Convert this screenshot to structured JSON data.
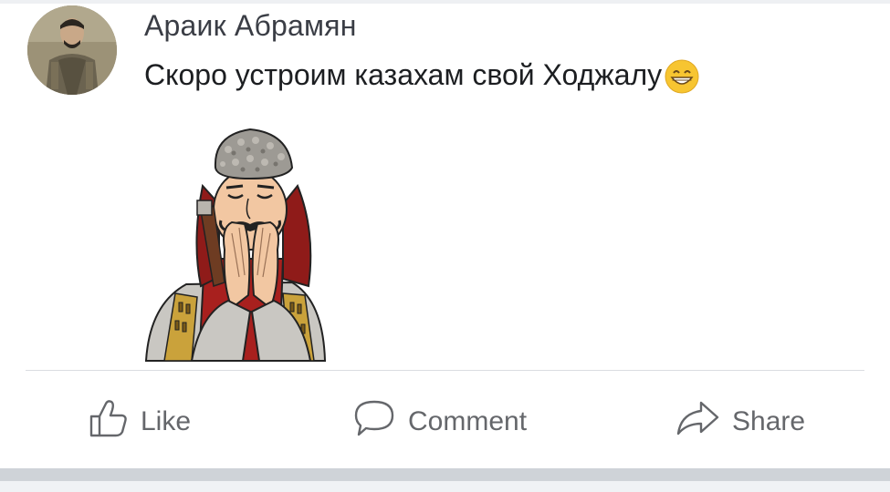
{
  "post": {
    "author": "Араик Абрамян",
    "text": "Скоро устроим казахам свой Ходжалу",
    "text_emoji": "grinning-face-emoji",
    "sticker": "man-in-papakha-sticker"
  },
  "actions": {
    "like_label": "Like",
    "comment_label": "Comment",
    "share_label": "Share",
    "like_icon": "thumbs-up-icon",
    "comment_icon": "speech-bubble-icon",
    "share_icon": "share-arrow-icon"
  },
  "colors": {
    "author_text": "#3a3d45",
    "body_text": "#1c1e21",
    "action_text": "#65676b",
    "divider": "#dadde1",
    "emoji_yellow": "#f7c531"
  }
}
